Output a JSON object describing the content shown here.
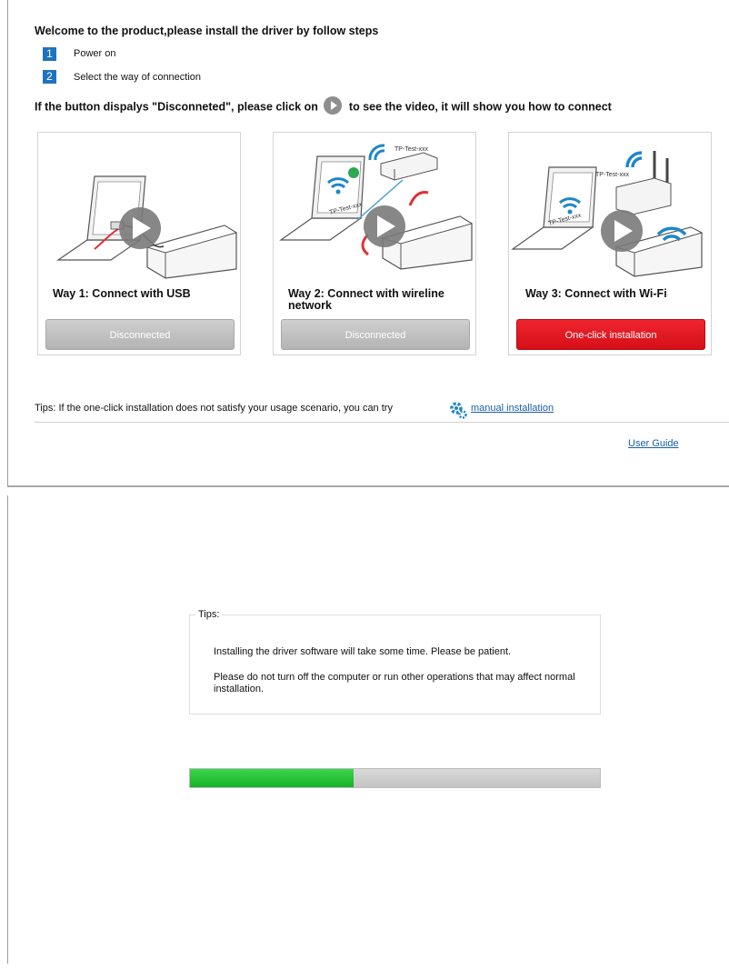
{
  "welcome": "Welcome to the product,please install the driver by follow steps",
  "steps": [
    {
      "num": "1",
      "text": "Power on"
    },
    {
      "num": "2",
      "text": "Select the way of connection"
    }
  ],
  "instruction": {
    "before": "If the button dispalys \"Disconneted\", please click on",
    "after": "to see the video, it will show you how to connect",
    "icon": "play-icon"
  },
  "cards": [
    {
      "title": "Way 1: Connect with USB",
      "button": "Disconnected",
      "button_state": "gray"
    },
    {
      "title": "Way 2: Connect with wireline network",
      "button": "Disconnected",
      "button_state": "gray",
      "label": "TP-Test-xxx",
      "laptop_label": "TP-Test-xxx"
    },
    {
      "title": "Way 3: Connect with Wi-Fi",
      "button": "One-click installation",
      "button_state": "red",
      "label": "TP-Test-xxx",
      "laptop_label": "TP-Test-xxx"
    }
  ],
  "tips": {
    "text": "Tips: If the one-click installation does not satisfy your usage scenario, you can try",
    "link": "manual installation",
    "icon": "gear-icon"
  },
  "user_guide": "User Guide",
  "install": {
    "tips_label": "Tips:",
    "line1": "Installing the driver software will take some time. Please be patient.",
    "line2": "Please do not turn off the computer or run other operations that may affect normal installation.",
    "progress": 0.4
  },
  "colors": {
    "accent_blue": "#1e73be",
    "red_button": "#e0141e",
    "progress_green": "#22c235",
    "link": "#1a5ea8"
  }
}
